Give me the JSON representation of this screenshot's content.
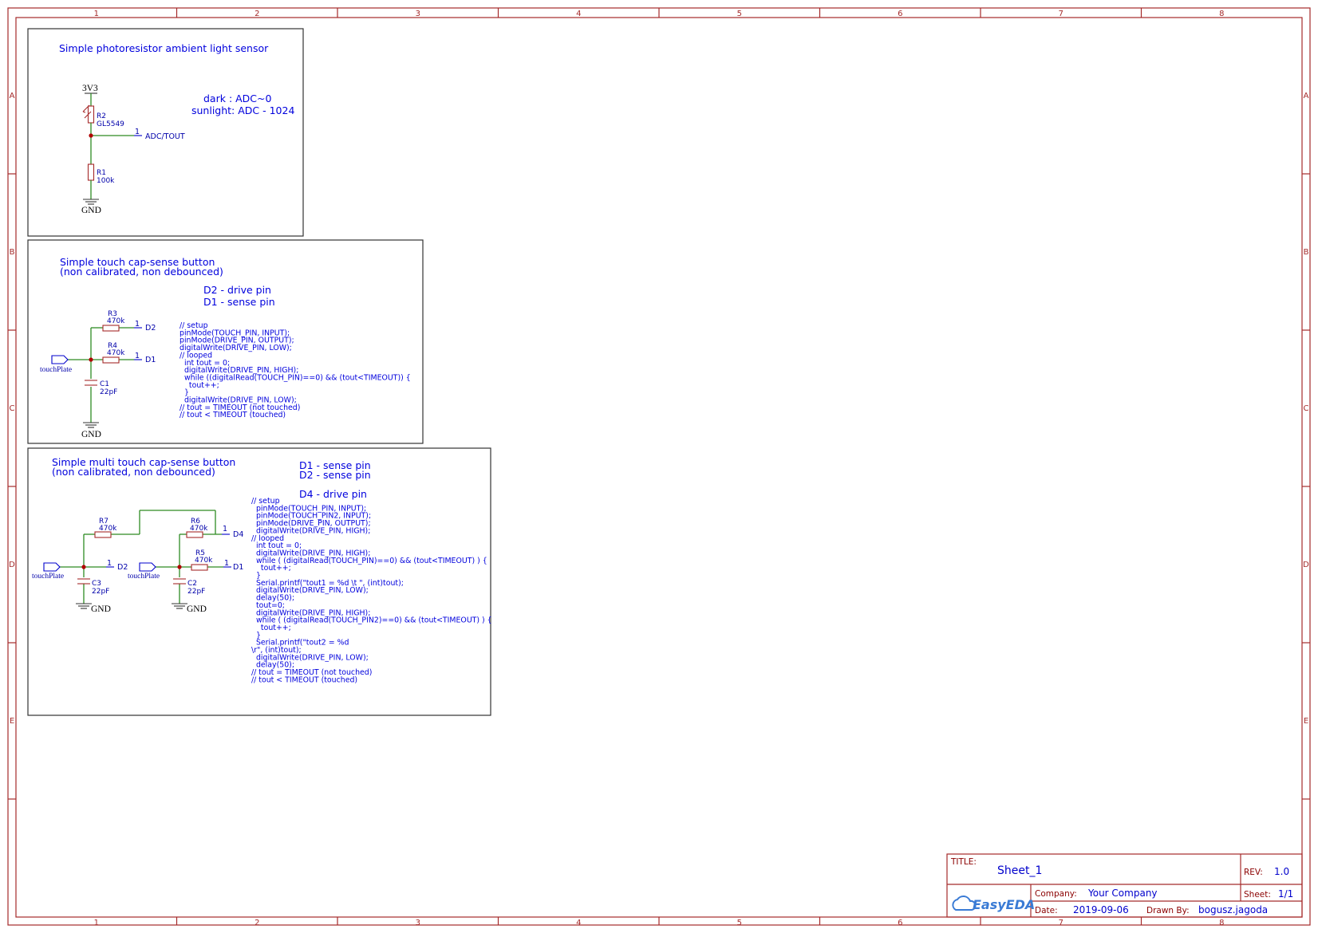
{
  "sheet": {
    "columns": [
      "1",
      "2",
      "3",
      "4",
      "5",
      "6",
      "7",
      "8"
    ],
    "rows": [
      "A",
      "B",
      "C",
      "D",
      "E"
    ]
  },
  "block1": {
    "title": "Simple photoresistor ambient light sensor",
    "note_lines": [
      "dark : ADC~0",
      "sunlight: ADC - 1024"
    ],
    "power": "3V3",
    "ground": "GND",
    "r2_ref": "R2",
    "r2_val": "GL5549",
    "r1_ref": "R1",
    "r1_val": "100k",
    "pin_num": "1",
    "pin_name": "ADC/TOUT"
  },
  "block2": {
    "title_lines": [
      "Simple touch cap-sense button",
      "(non calibrated, non debounced)"
    ],
    "note_lines": [
      "D2 - drive pin",
      "D1 - sense pin"
    ],
    "r3_ref": "R3",
    "r3_val": "470k",
    "r4_ref": "R4",
    "r4_val": "470k",
    "c1_ref": "C1",
    "c1_val": "22pF",
    "pin_num": "1",
    "pin_d2": "D2",
    "pin_d1": "D1",
    "port": "touchPlate",
    "ground": "GND",
    "code": [
      "// setup",
      "pinMode(TOUCH_PIN, INPUT);",
      "pinMode(DRIVE_PIN, OUTPUT);",
      "digitalWrite(DRIVE_PIN, LOW);",
      "// looped",
      "  int tout = 0;",
      "  digitalWrite(DRIVE_PIN, HIGH);",
      "  while ((digitalRead(TOUCH_PIN)==0) && (tout<TIMEOUT)) {",
      "    tout++;",
      "  }",
      "  digitalWrite(DRIVE_PIN, LOW);",
      "// tout = TIMEOUT (not touched)",
      "// tout < TIMEOUT (touched)"
    ]
  },
  "block3": {
    "title_lines": [
      "Simple multi touch cap-sense button",
      "(non calibrated, non debounced)"
    ],
    "note_lines": [
      "D1 - sense pin",
      "D2 - sense pin",
      "D4 - drive pin"
    ],
    "r7_ref": "R7",
    "r7_val": "470k",
    "r6_ref": "R6",
    "r6_val": "470k",
    "r5_ref": "R5",
    "r5_val": "470k",
    "c3_ref": "C3",
    "c3_val": "22pF",
    "c2_ref": "C2",
    "c2_val": "22pF",
    "pin_num": "1",
    "pin_d2": "D2",
    "pin_d4": "D4",
    "pin_d1": "D1",
    "port": "touchPlate",
    "ground": "GND",
    "code": [
      "// setup",
      "  pinMode(TOUCH_PIN, INPUT);",
      "  pinMode(TOUCH_PIN2, INPUT);",
      "  pinMode(DRIVE_PIN, OUTPUT);",
      "  digitalWrite(DRIVE_PIN, HIGH);",
      "// looped",
      "  int tout = 0;",
      "  digitalWrite(DRIVE_PIN, HIGH);",
      "  while ( (digitalRead(TOUCH_PIN)==0) && (tout<TIMEOUT) ) {",
      "    tout++;",
      "  }",
      "  Serial.printf(\"tout1 = %d \\t \", (int)tout);",
      "  digitalWrite(DRIVE_PIN, LOW);",
      "  delay(50);",
      "  tout=0;",
      "  digitalWrite(DRIVE_PIN, HIGH);",
      "  while ( (digitalRead(TOUCH_PIN2)==0) && (tout<TIMEOUT) ) {",
      "    tout++;",
      "  }",
      "  Serial.printf(\"tout2 = %d",
      "\\r\", (int)tout);",
      "  digitalWrite(DRIVE_PIN, LOW);",
      "  delay(50);",
      "// tout = TIMEOUT (not touched)",
      "// tout < TIMEOUT (touched)"
    ]
  },
  "titleblock": {
    "title_label": "TITLE:",
    "title": "Sheet_1",
    "rev_label": "REV:",
    "rev": "1.0",
    "company_label": "Company:",
    "company": "Your Company",
    "sheet_label": "Sheet:",
    "sheet": "1/1",
    "date_label": "Date:",
    "date": "2019-09-06",
    "drawn_label": "Drawn By:",
    "drawn": "bogusz.jagoda",
    "logo": "EasyEDA"
  }
}
